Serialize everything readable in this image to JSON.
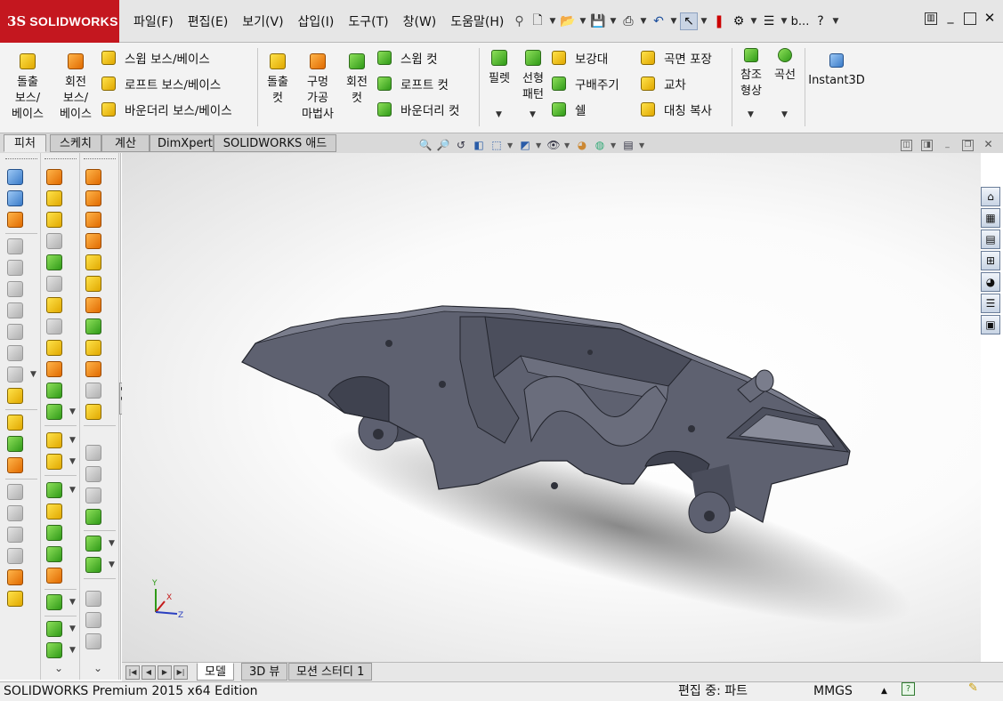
{
  "app": {
    "logo_ds": "3S",
    "logo_text": "SOLIDWORKS",
    "logo_color": "#c4171f"
  },
  "menu": [
    "파일(F)",
    "편집(E)",
    "보기(V)",
    "삽입(I)",
    "도구(T)",
    "창(W)",
    "도움말(H)"
  ],
  "quick_access": {
    "icons": [
      "new-icon",
      "open-icon",
      "save-icon",
      "print-icon",
      "undo-icon",
      "select-icon",
      "rebuild-icon",
      "options-icon",
      "file-properties-icon"
    ],
    "user_label": "b...",
    "help_glyph": "?"
  },
  "ribbon": {
    "extrude_boss": "돌출\n보스/\n베이스",
    "revolve_boss": "회전\n보스/\n베이스",
    "sweep_boss": "스윕 보스/베이스",
    "loft_boss": "로프트 보스/베이스",
    "boundary_boss": "바운더리 보스/베이스",
    "extrude_cut": "돌출\n컷",
    "hole_wizard": "구멍\n가공\n마법사",
    "revolve_cut": "회전\n컷",
    "sweep_cut": "스윕 컷",
    "loft_cut": "로프트 컷",
    "boundary_cut": "바운더리 컷",
    "fillet": "필렛",
    "linear_pattern": "선형\n패턴",
    "rib": "보강대",
    "draft": "구배주기",
    "shell": "쉘",
    "wrap": "곡면 포장",
    "intersect": "교차",
    "mirror": "대칭 복사",
    "ref_geometry": "참조\n형상",
    "curves": "곡선",
    "instant3d": "Instant3D"
  },
  "command_tabs": [
    "피처",
    "스케치",
    "계산",
    "DimXpert",
    "SOLIDWORKS 애드인"
  ],
  "active_command_tab": "피처",
  "view_toolbar_icons": [
    "zoom-to-fit-icon",
    "zoom-to-area-icon",
    "previous-view-icon",
    "section-view-icon",
    "view-orientation-icon",
    "display-style-icon",
    "hide-show-items-icon",
    "appearance-icon",
    "scenes-icon",
    "view-settings-icon"
  ],
  "task_pane_icons": [
    "home-icon",
    "design-library-icon",
    "file-explorer-icon",
    "view-palette-icon",
    "appearances-icon",
    "custom-properties-icon",
    "forum-icon"
  ],
  "triad": {
    "x": "X",
    "y": "Y",
    "z": "Z"
  },
  "model": {
    "body_color": "#5e6170",
    "description": "3D part model of a car chassis with four wheel stubs"
  },
  "bottom_tabs": [
    "모델",
    "3D 뷰",
    "모션 스터디 1"
  ],
  "active_bottom_tab": "모델",
  "status": {
    "product": "SOLIDWORKS Premium 2015 x64 Edition",
    "editing": "편집 중: 파트",
    "units": "MMGS",
    "units_arrow": "▲"
  }
}
